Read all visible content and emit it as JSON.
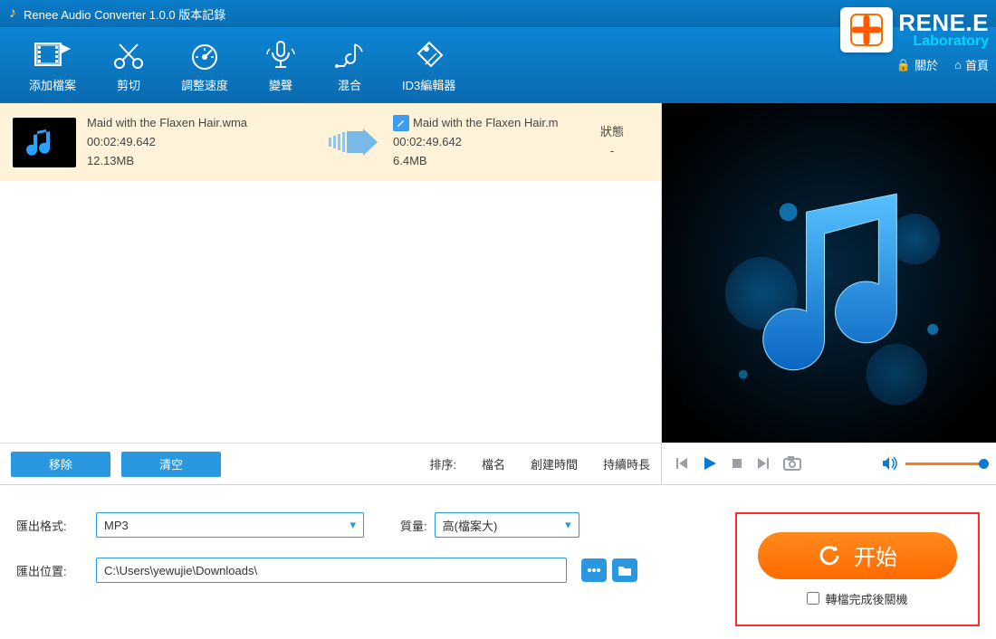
{
  "titlebar": {
    "title": "Renee Audio Converter 1.0.0 版本記錄"
  },
  "brand": {
    "name": "RENE.E",
    "sub": "Laboratory",
    "about": "關於",
    "home": "首頁"
  },
  "toolbar": {
    "add": "添加檔案",
    "cut": "剪切",
    "speed": "調整速度",
    "voice": "變聲",
    "mix": "混合",
    "id3": "ID3編輯器"
  },
  "file": {
    "src_name": "Maid with the Flaxen Hair.wma",
    "src_duration": "00:02:49.642",
    "src_size": "12.13MB",
    "out_name": "Maid with the Flaxen Hair.m",
    "out_duration": "00:02:49.642",
    "out_size": "6.4MB",
    "status_label": "狀態",
    "status_value": "-"
  },
  "list_actions": {
    "remove": "移除",
    "clear": "清空"
  },
  "sort": {
    "label": "排序:",
    "by_name": "檔名",
    "by_created": "創建時間",
    "by_duration": "持續時長"
  },
  "settings": {
    "format_label": "匯出格式:",
    "format_value": "MP3",
    "quality_label": "質量:",
    "quality_value": "高(檔案大)",
    "path_label": "匯出位置:",
    "path_value": "C:\\Users\\yewujie\\Downloads\\"
  },
  "start": {
    "label": "开始",
    "shutdown": "轉檔完成後關機"
  },
  "colors": {
    "accent": "#0b7ad1",
    "orange": "#ff7a18"
  }
}
